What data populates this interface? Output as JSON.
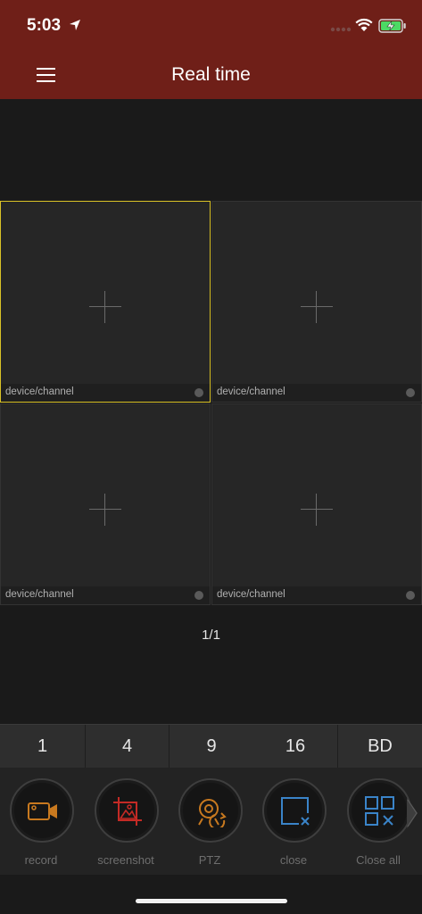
{
  "status": {
    "time": "5:03"
  },
  "nav": {
    "title": "Real time"
  },
  "cells": [
    {
      "label": "device/channel"
    },
    {
      "label": "device/channel"
    },
    {
      "label": "device/channel"
    },
    {
      "label": "device/channel"
    }
  ],
  "pager": {
    "text": "1/1"
  },
  "split": [
    "1",
    "4",
    "9",
    "16",
    "BD"
  ],
  "tools": [
    {
      "label": "record",
      "icon": "video-camera-icon",
      "color": "#c8791f"
    },
    {
      "label": "screenshot",
      "icon": "image-capture-icon",
      "color": "#c42a25"
    },
    {
      "label": "PTZ",
      "icon": "ptz-rotate-icon",
      "color": "#c8791f"
    },
    {
      "label": "close",
      "icon": "close-window-icon",
      "color": "#3a84c9"
    },
    {
      "label": "Close all",
      "icon": "close-all-grid-icon",
      "color": "#3a84c9"
    }
  ],
  "colors": {
    "header": "#6f1f18",
    "selected_border": "#d9c227",
    "battery": "#4cd964"
  }
}
